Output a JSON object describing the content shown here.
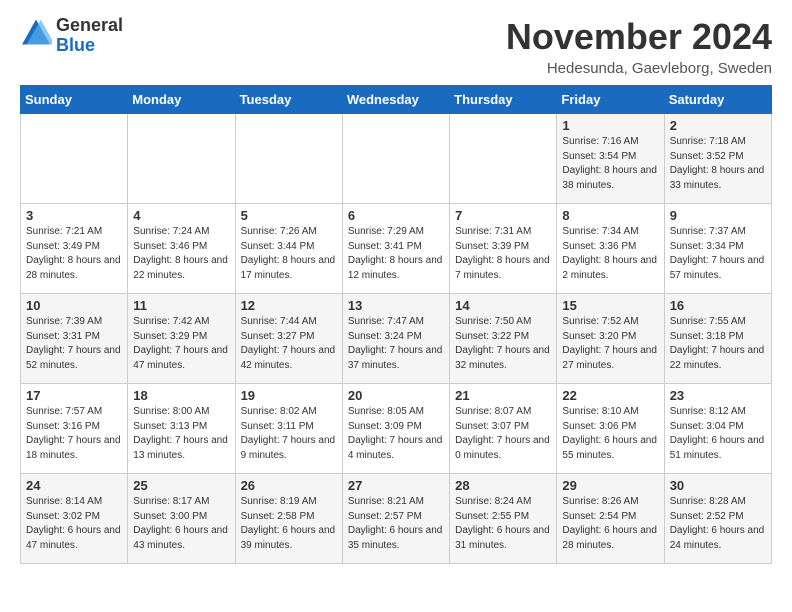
{
  "header": {
    "logo_general": "General",
    "logo_blue": "Blue",
    "month_title": "November 2024",
    "subtitle": "Hedesunda, Gaevleborg, Sweden"
  },
  "days_of_week": [
    "Sunday",
    "Monday",
    "Tuesday",
    "Wednesday",
    "Thursday",
    "Friday",
    "Saturday"
  ],
  "weeks": [
    [
      {
        "day": "",
        "info": ""
      },
      {
        "day": "",
        "info": ""
      },
      {
        "day": "",
        "info": ""
      },
      {
        "day": "",
        "info": ""
      },
      {
        "day": "",
        "info": ""
      },
      {
        "day": "1",
        "info": "Sunrise: 7:16 AM\nSunset: 3:54 PM\nDaylight: 8 hours\nand 38 minutes."
      },
      {
        "day": "2",
        "info": "Sunrise: 7:18 AM\nSunset: 3:52 PM\nDaylight: 8 hours\nand 33 minutes."
      }
    ],
    [
      {
        "day": "3",
        "info": "Sunrise: 7:21 AM\nSunset: 3:49 PM\nDaylight: 8 hours\nand 28 minutes."
      },
      {
        "day": "4",
        "info": "Sunrise: 7:24 AM\nSunset: 3:46 PM\nDaylight: 8 hours\nand 22 minutes."
      },
      {
        "day": "5",
        "info": "Sunrise: 7:26 AM\nSunset: 3:44 PM\nDaylight: 8 hours\nand 17 minutes."
      },
      {
        "day": "6",
        "info": "Sunrise: 7:29 AM\nSunset: 3:41 PM\nDaylight: 8 hours\nand 12 minutes."
      },
      {
        "day": "7",
        "info": "Sunrise: 7:31 AM\nSunset: 3:39 PM\nDaylight: 8 hours\nand 7 minutes."
      },
      {
        "day": "8",
        "info": "Sunrise: 7:34 AM\nSunset: 3:36 PM\nDaylight: 8 hours\nand 2 minutes."
      },
      {
        "day": "9",
        "info": "Sunrise: 7:37 AM\nSunset: 3:34 PM\nDaylight: 7 hours\nand 57 minutes."
      }
    ],
    [
      {
        "day": "10",
        "info": "Sunrise: 7:39 AM\nSunset: 3:31 PM\nDaylight: 7 hours\nand 52 minutes."
      },
      {
        "day": "11",
        "info": "Sunrise: 7:42 AM\nSunset: 3:29 PM\nDaylight: 7 hours\nand 47 minutes."
      },
      {
        "day": "12",
        "info": "Sunrise: 7:44 AM\nSunset: 3:27 PM\nDaylight: 7 hours\nand 42 minutes."
      },
      {
        "day": "13",
        "info": "Sunrise: 7:47 AM\nSunset: 3:24 PM\nDaylight: 7 hours\nand 37 minutes."
      },
      {
        "day": "14",
        "info": "Sunrise: 7:50 AM\nSunset: 3:22 PM\nDaylight: 7 hours\nand 32 minutes."
      },
      {
        "day": "15",
        "info": "Sunrise: 7:52 AM\nSunset: 3:20 PM\nDaylight: 7 hours\nand 27 minutes."
      },
      {
        "day": "16",
        "info": "Sunrise: 7:55 AM\nSunset: 3:18 PM\nDaylight: 7 hours\nand 22 minutes."
      }
    ],
    [
      {
        "day": "17",
        "info": "Sunrise: 7:57 AM\nSunset: 3:16 PM\nDaylight: 7 hours\nand 18 minutes."
      },
      {
        "day": "18",
        "info": "Sunrise: 8:00 AM\nSunset: 3:13 PM\nDaylight: 7 hours\nand 13 minutes."
      },
      {
        "day": "19",
        "info": "Sunrise: 8:02 AM\nSunset: 3:11 PM\nDaylight: 7 hours\nand 9 minutes."
      },
      {
        "day": "20",
        "info": "Sunrise: 8:05 AM\nSunset: 3:09 PM\nDaylight: 7 hours\nand 4 minutes."
      },
      {
        "day": "21",
        "info": "Sunrise: 8:07 AM\nSunset: 3:07 PM\nDaylight: 7 hours\nand 0 minutes."
      },
      {
        "day": "22",
        "info": "Sunrise: 8:10 AM\nSunset: 3:06 PM\nDaylight: 6 hours\nand 55 minutes."
      },
      {
        "day": "23",
        "info": "Sunrise: 8:12 AM\nSunset: 3:04 PM\nDaylight: 6 hours\nand 51 minutes."
      }
    ],
    [
      {
        "day": "24",
        "info": "Sunrise: 8:14 AM\nSunset: 3:02 PM\nDaylight: 6 hours\nand 47 minutes."
      },
      {
        "day": "25",
        "info": "Sunrise: 8:17 AM\nSunset: 3:00 PM\nDaylight: 6 hours\nand 43 minutes."
      },
      {
        "day": "26",
        "info": "Sunrise: 8:19 AM\nSunset: 2:58 PM\nDaylight: 6 hours\nand 39 minutes."
      },
      {
        "day": "27",
        "info": "Sunrise: 8:21 AM\nSunset: 2:57 PM\nDaylight: 6 hours\nand 35 minutes."
      },
      {
        "day": "28",
        "info": "Sunrise: 8:24 AM\nSunset: 2:55 PM\nDaylight: 6 hours\nand 31 minutes."
      },
      {
        "day": "29",
        "info": "Sunrise: 8:26 AM\nSunset: 2:54 PM\nDaylight: 6 hours\nand 28 minutes."
      },
      {
        "day": "30",
        "info": "Sunrise: 8:28 AM\nSunset: 2:52 PM\nDaylight: 6 hours\nand 24 minutes."
      }
    ]
  ]
}
